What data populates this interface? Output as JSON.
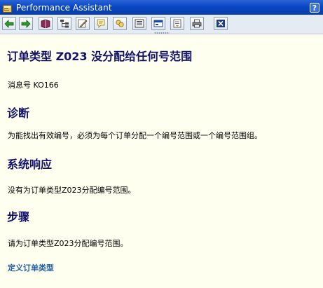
{
  "window": {
    "title": "Performance Assistant",
    "help_icon": "help-icon",
    "app_icon": "sap-app-icon"
  },
  "toolbar": {
    "buttons": [
      {
        "name": "back-button",
        "icon": "arrow-left-icon"
      },
      {
        "name": "forward-button",
        "icon": "arrow-right-icon"
      },
      {
        "name": "technical-info-button",
        "icon": "book-icon"
      },
      {
        "name": "structure-button",
        "icon": "hierarchy-icon"
      },
      {
        "name": "edit-button",
        "icon": "pencil-icon"
      },
      {
        "name": "annotation-button",
        "icon": "note-icon"
      },
      {
        "name": "links-button",
        "icon": "link-icon"
      },
      {
        "name": "document-button",
        "icon": "document-icon"
      },
      {
        "name": "display-button",
        "icon": "window-icon"
      },
      {
        "name": "settings-button",
        "icon": "settings-icon"
      },
      {
        "name": "print-button",
        "icon": "printer-icon"
      },
      {
        "name": "close-button",
        "icon": "close-icon"
      }
    ]
  },
  "colors": {
    "background": "#fffff0",
    "heading": "#12126a",
    "link": "#1f5fa8",
    "titlebar": "#0a47c4"
  },
  "message": {
    "title": "订单类型  Z023 没分配给任何号范围",
    "number_line": "消息号  KO166"
  },
  "sections": {
    "diagnosis": {
      "heading": "诊断",
      "text": "为能找出有效编号，必须为每个订单分配一个编号范围或一个编号范围组。"
    },
    "system_response": {
      "heading": "系统响应",
      "text": "没有为订单类型Z023分配编号范围。"
    },
    "procedure": {
      "heading": "步骤",
      "text": "请为订单类型Z023分配编号范围。"
    }
  },
  "link": {
    "label": "定义订单类型"
  }
}
